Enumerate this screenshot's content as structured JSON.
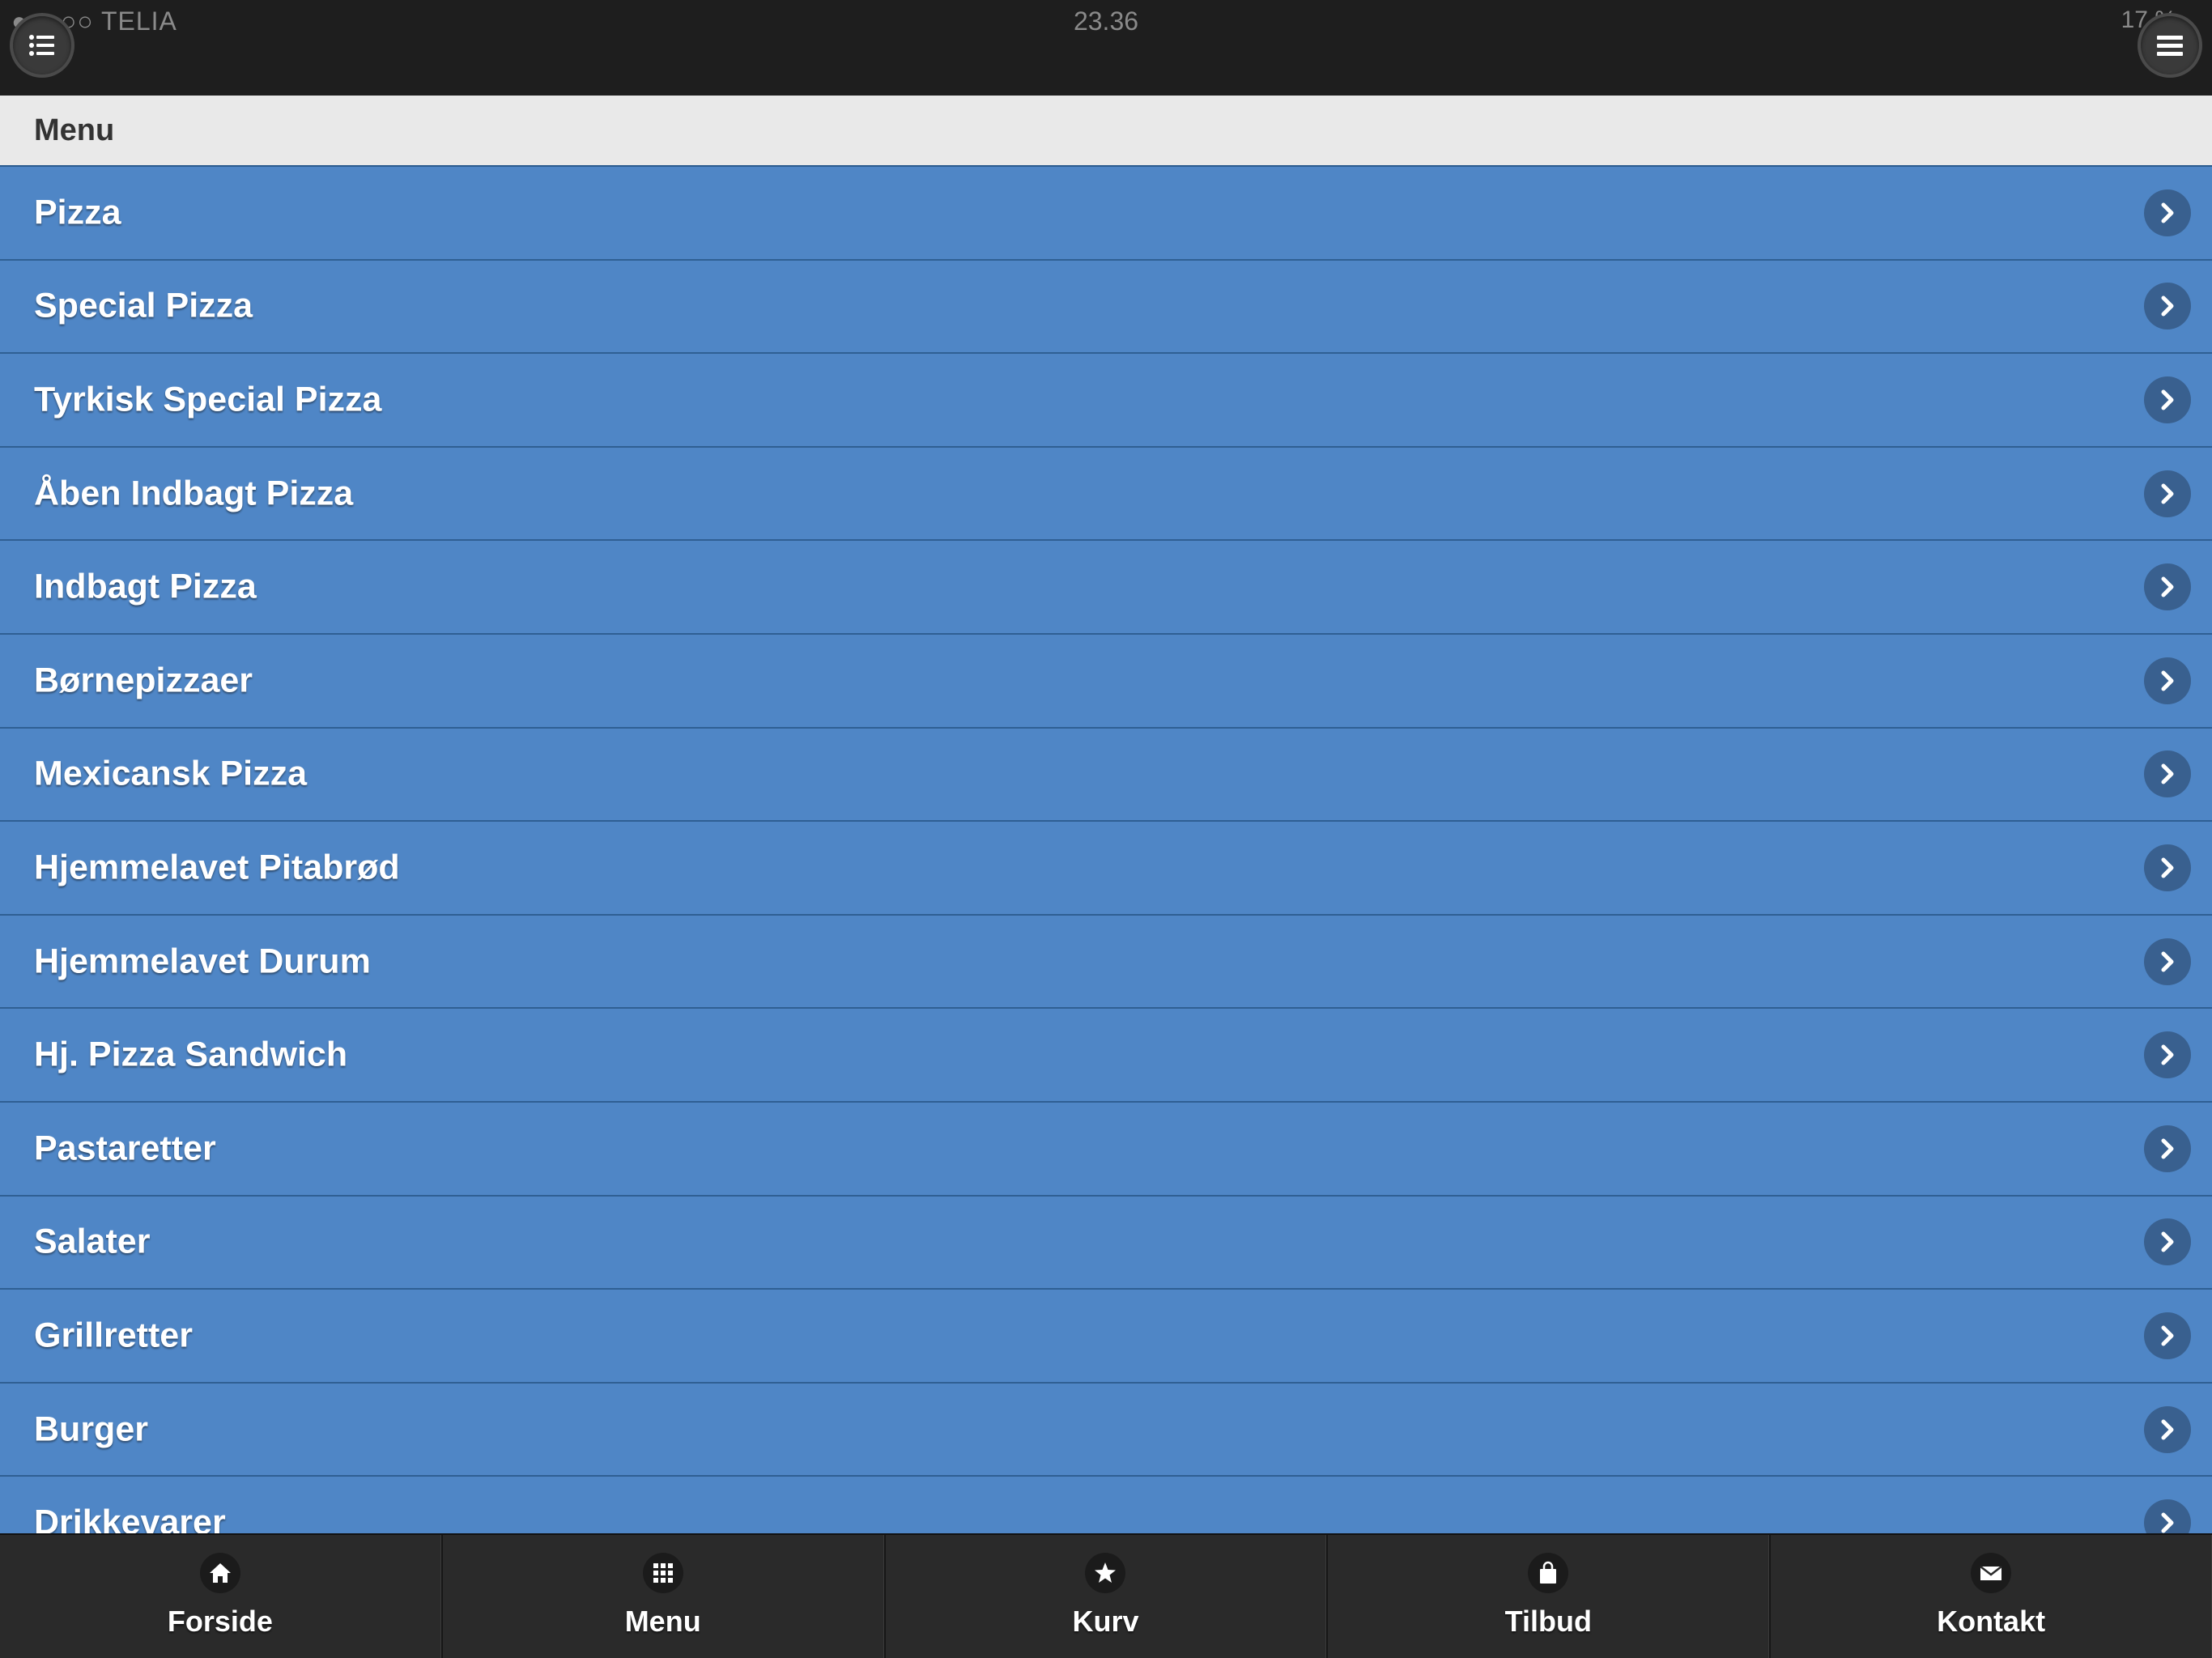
{
  "status_bar": {
    "carrier": "●●●○○ TELIA",
    "time": "23.36",
    "battery": "17 %"
  },
  "header": {
    "left_icon": "list-icon",
    "right_icon": "hamburger-icon"
  },
  "section": {
    "title": "Menu"
  },
  "menu_items": [
    {
      "label": "Pizza"
    },
    {
      "label": "Special Pizza"
    },
    {
      "label": "Tyrkisk Special Pizza"
    },
    {
      "label": "Åben Indbagt Pizza"
    },
    {
      "label": "Indbagt Pizza"
    },
    {
      "label": "Børnepizzaer"
    },
    {
      "label": "Mexicansk Pizza"
    },
    {
      "label": "Hjemmelavet Pitabrød"
    },
    {
      "label": "Hjemmelavet Durum"
    },
    {
      "label": "Hj. Pizza Sandwich"
    },
    {
      "label": "Pastaretter"
    },
    {
      "label": "Salater"
    },
    {
      "label": "Grillretter"
    },
    {
      "label": "Burger"
    },
    {
      "label": "Drikkevarer"
    }
  ],
  "tabs": [
    {
      "label": "Forside",
      "icon": "home-icon"
    },
    {
      "label": "Menu",
      "icon": "grid-icon"
    },
    {
      "label": "Kurv",
      "icon": "star-icon"
    },
    {
      "label": "Tilbud",
      "icon": "shopping-bag-icon"
    },
    {
      "label": "Kontakt",
      "icon": "mail-icon"
    }
  ],
  "colors": {
    "list_background": "#4f86c6",
    "bar_background": "#2a2a2a",
    "header_background": "#e9e9e9"
  }
}
